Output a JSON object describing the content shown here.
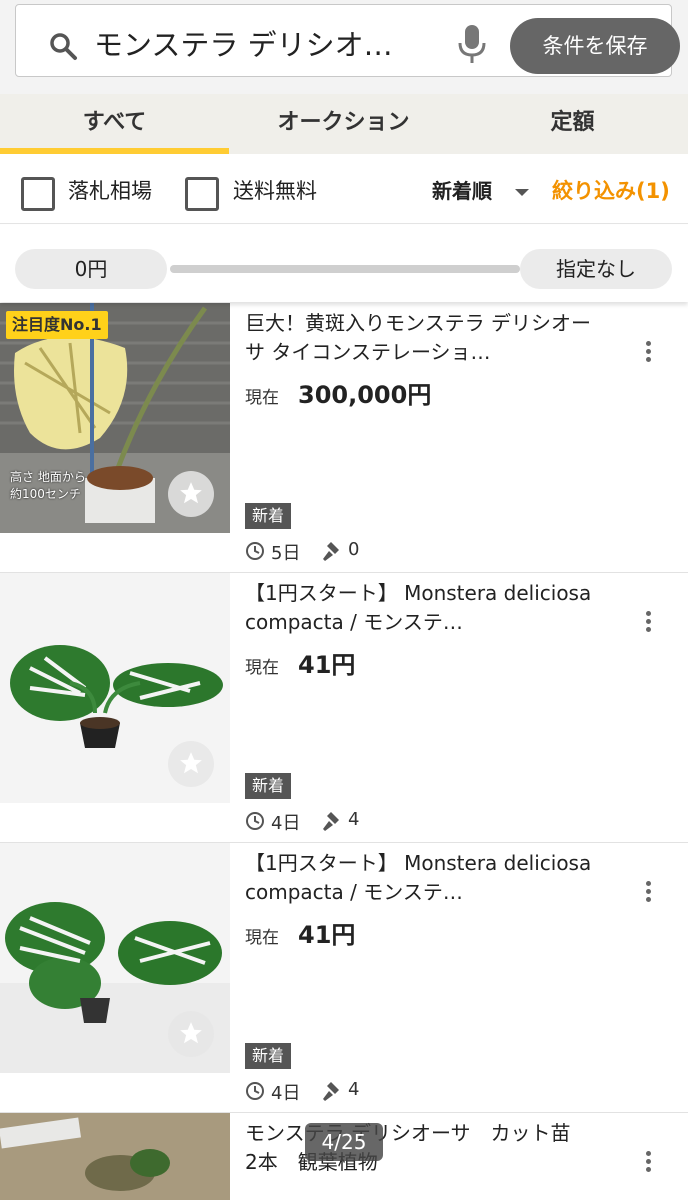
{
  "search": {
    "query": "モンステラ デリシオ…",
    "save_label": "条件を保存"
  },
  "tabs": [
    {
      "label": "すべて",
      "active": true
    },
    {
      "label": "オークション",
      "active": false
    },
    {
      "label": "定額",
      "active": false
    }
  ],
  "filters": {
    "checkbox1": "落札相場",
    "checkbox2": "送料無料",
    "sort": "新着順",
    "refine": "絞り込み(1)"
  },
  "price_range": {
    "min": "0円",
    "max": "指定なし"
  },
  "items": [
    {
      "title": "巨大！黄斑入りモンステラ デリシオーサ タイコンステレーショ…",
      "price_label": "現在",
      "price": "300,000円",
      "badge": "新着",
      "days": "5日",
      "bids": "0",
      "top_badge": "注目度No.1",
      "caption_line1": "高さ 地面から",
      "caption_line2": "約100センチ"
    },
    {
      "title": "【1円スタート】 Monstera deliciosa compacta / モンステ…",
      "price_label": "現在",
      "price": "41円",
      "badge": "新着",
      "days": "4日",
      "bids": "4"
    },
    {
      "title": "【1円スタート】 Monstera deliciosa compacta / モンステ…",
      "price_label": "現在",
      "price": "41円",
      "badge": "新着",
      "days": "4日",
      "bids": "4"
    },
    {
      "title": "モンステラ デリシオーサ　カット苗　2本　観葉植物"
    }
  ],
  "page_indicator": "4/25",
  "colors": {
    "accent_tab": "#ffcc33",
    "refine": "#f39200",
    "badge_top": "#ffd11a"
  }
}
